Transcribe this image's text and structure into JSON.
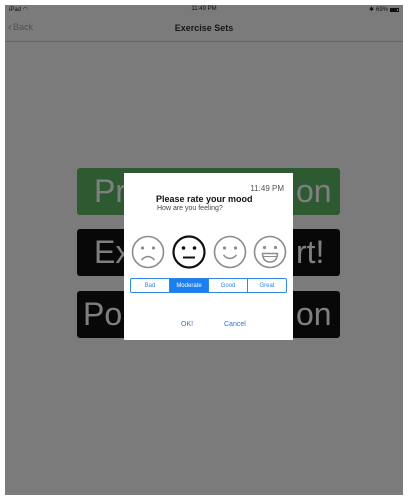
{
  "status_bar": {
    "carrier": "iPad",
    "wifi_icon": "wifi-icon",
    "time": "11:49 PM",
    "battery_text": "69%",
    "battery_icon": "battery-icon"
  },
  "nav": {
    "back_label": "Back",
    "title": "Exercise Sets"
  },
  "background_buttons": [
    {
      "visible_left": "Pr",
      "visible_right": "on",
      "color": "#5ab561"
    },
    {
      "visible_left": "Ex",
      "visible_right": "rt!",
      "color": "#111111"
    },
    {
      "visible_left": "Po",
      "visible_right": "on",
      "color": "#111111"
    }
  ],
  "alert": {
    "time": "11:49 PM",
    "title": "Please rate your mood",
    "subtitle": "How are you feeling?",
    "faces": [
      "sad-face-icon",
      "neutral-face-icon",
      "smile-face-icon",
      "grin-face-icon"
    ],
    "options": [
      "Bad",
      "Moderate",
      "Good",
      "Great"
    ],
    "selected_option": "Moderate",
    "ok_label": "OK!",
    "cancel_label": "Cancel",
    "accent_color": "#1a7ff0"
  }
}
